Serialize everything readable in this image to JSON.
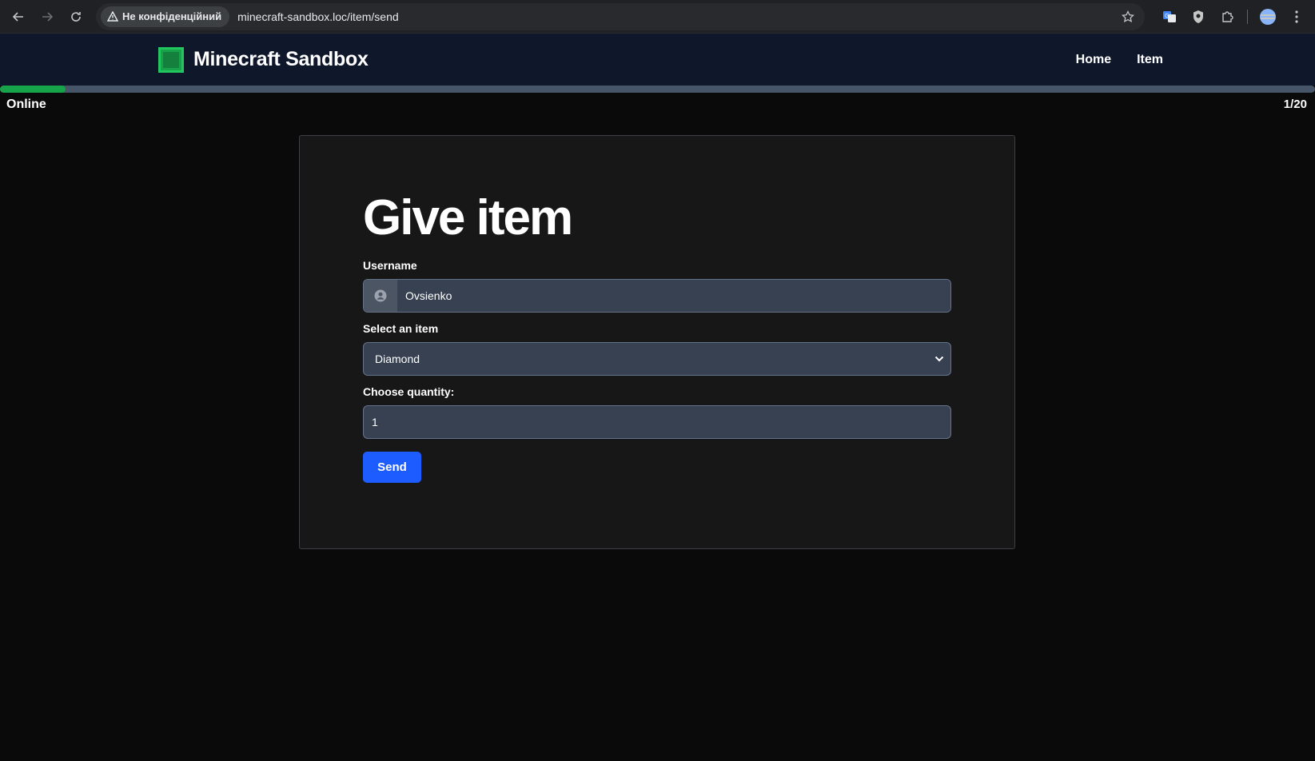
{
  "browser": {
    "security_label": "Не конфіденційний",
    "url": "minecraft-sandbox.loc/item/send"
  },
  "site": {
    "brand_name": "Minecraft Sandbox",
    "nav": [
      "Home",
      "Item"
    ]
  },
  "status": {
    "label": "Online",
    "count": "1/20",
    "progress_fraction": 0.05
  },
  "form": {
    "title": "Give item",
    "username_label": "Username",
    "username_value": "Ovsienko",
    "item_label": "Select an item",
    "item_selected": "Diamond",
    "quantity_label": "Choose quantity:",
    "quantity_value": "1",
    "submit_label": "Send"
  },
  "colors": {
    "header_bg": "#0f172a",
    "progress_fill": "#16a34a",
    "button": "#1d5cff"
  }
}
